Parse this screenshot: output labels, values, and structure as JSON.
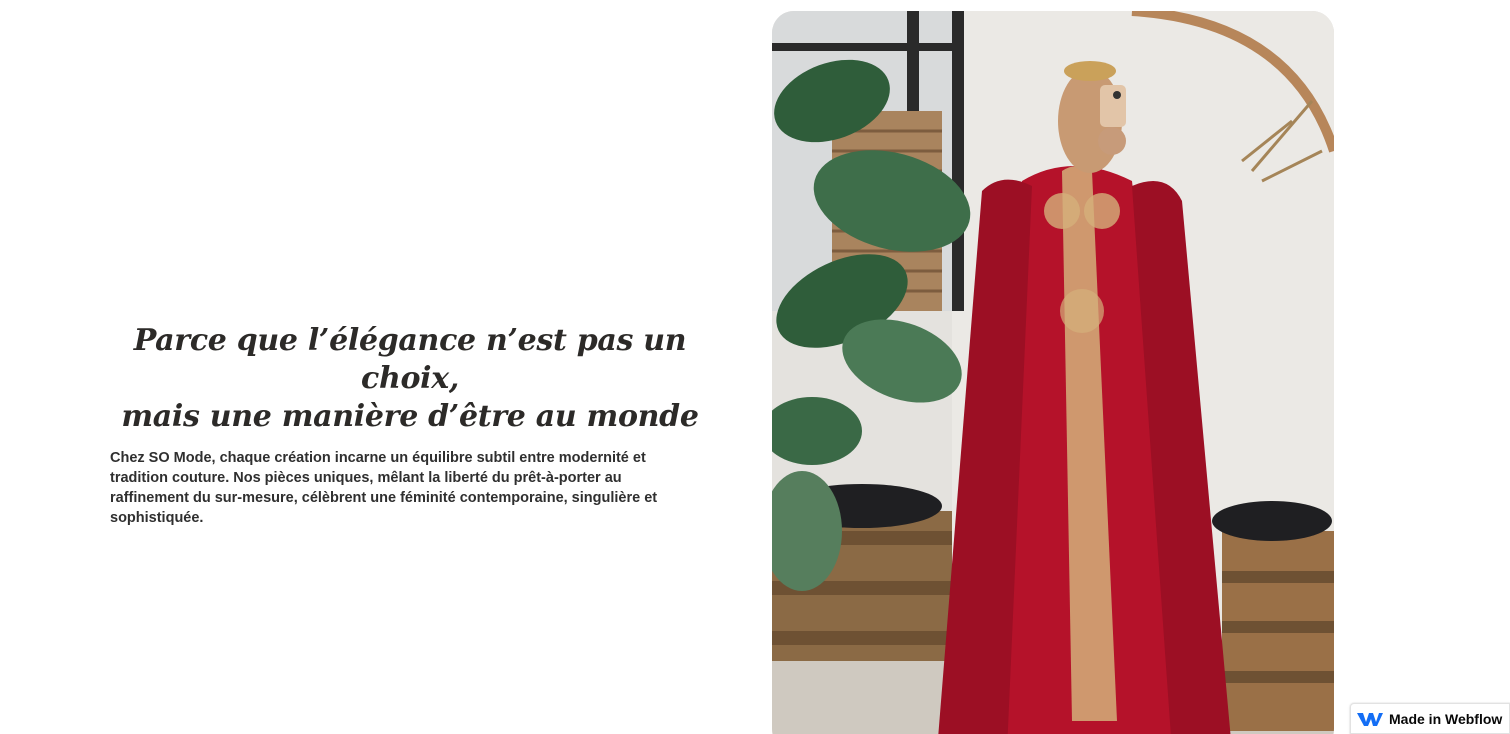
{
  "hero": {
    "headline_line1": "Parce que l’élégance n’est pas un choix,",
    "headline_line2": "mais une manière d’être au monde",
    "body": "Chez SO Mode, chaque création incarne un équilibre subtil entre modernité et tradition couture. Nos pièces uniques, mêlant la liberté du prêt-à-porter au raffinement du sur-mesure, célèbrent une féminité contemporaine, singulière et sophistiquée."
  },
  "image": {
    "subject": "woman-in-red-embroidered-gown-photo"
  },
  "badge": {
    "label": "Made in Webflow",
    "icon": "webflow-logo-icon",
    "accent": "#146ef5"
  },
  "colors": {
    "headline": "#2c2a28",
    "dress": "#b5122a",
    "gold": "#d4b07a"
  }
}
